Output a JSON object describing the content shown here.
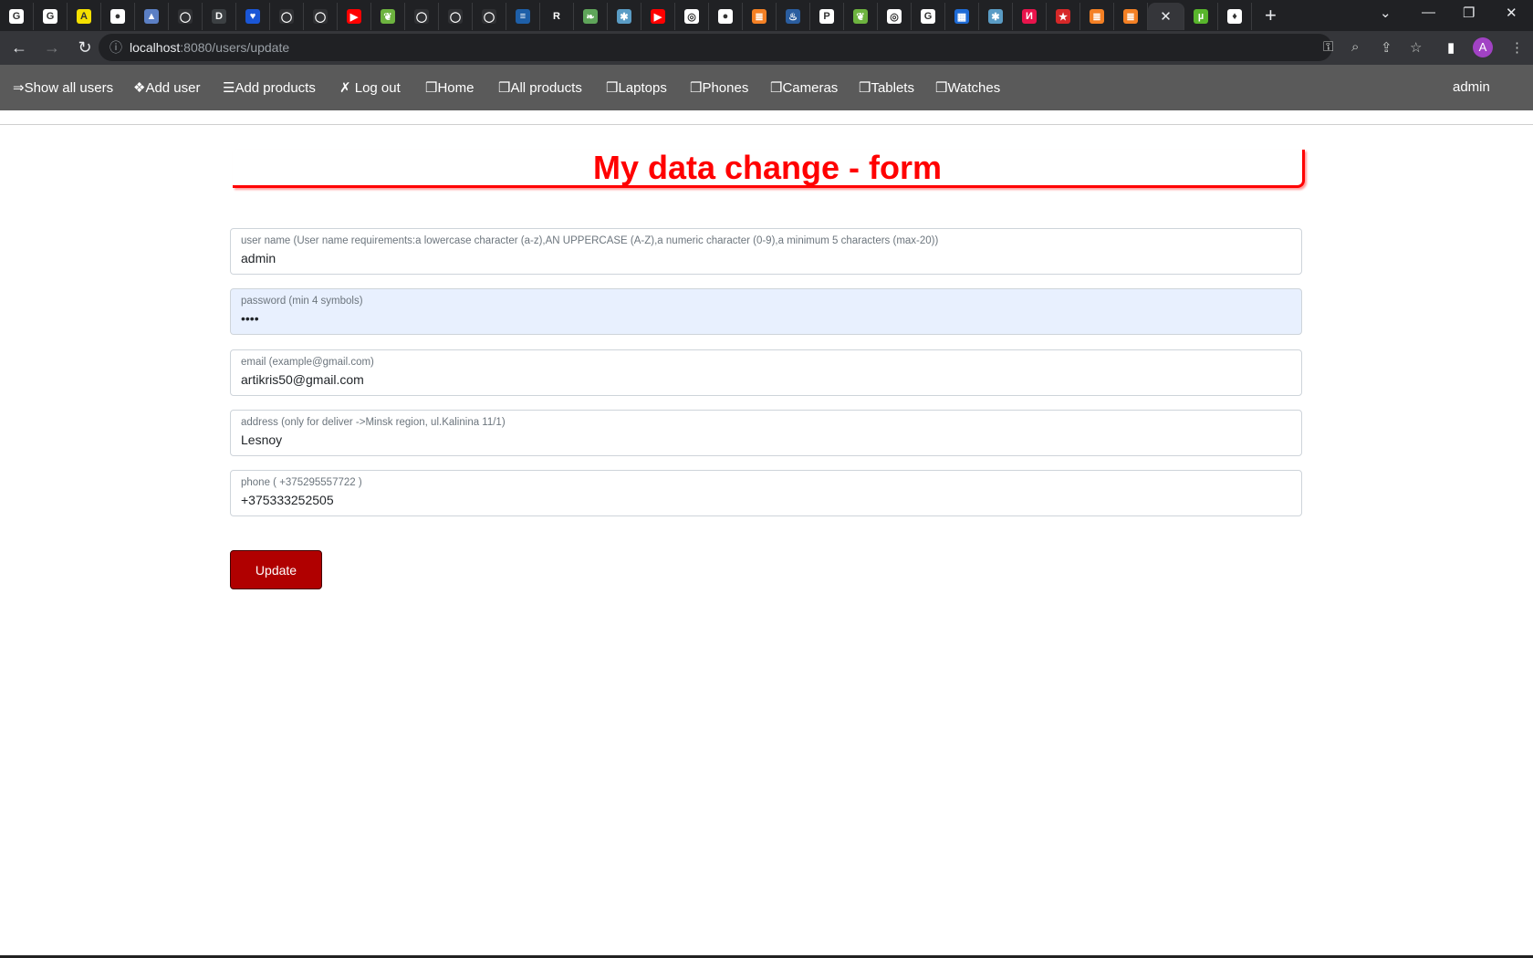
{
  "browser": {
    "tabs": [
      {
        "icon": "google-icon",
        "color": "#ffffff",
        "glyph": "G"
      },
      {
        "icon": "google-icon",
        "color": "#ffffff",
        "glyph": "G"
      },
      {
        "icon": "a-logo-icon",
        "color": "#f5e000",
        "glyph": "A"
      },
      {
        "icon": "globe-icon",
        "color": "#ffffff",
        "glyph": "●"
      },
      {
        "icon": "docs-icon",
        "color": "#5b7fc4",
        "glyph": "▲"
      },
      {
        "icon": "github-icon",
        "color": "#303134",
        "glyph": "◯"
      },
      {
        "icon": "d-logo-icon",
        "color": "#3c4043",
        "glyph": "D"
      },
      {
        "icon": "heart-icon",
        "color": "#1a56d6",
        "glyph": "♥"
      },
      {
        "icon": "github-icon",
        "color": "#303134",
        "glyph": "◯"
      },
      {
        "icon": "github-icon",
        "color": "#303134",
        "glyph": "◯"
      },
      {
        "icon": "youtube-icon",
        "color": "#ff0000",
        "glyph": "▶"
      },
      {
        "icon": "spring-icon",
        "color": "#6db33f",
        "glyph": "❦"
      },
      {
        "icon": "github-icon",
        "color": "#303134",
        "glyph": "◯"
      },
      {
        "icon": "github-icon",
        "color": "#303134",
        "glyph": "◯"
      },
      {
        "icon": "github-icon",
        "color": "#303134",
        "glyph": "◯"
      },
      {
        "icon": "stackexchange-icon",
        "color": "#1e5fa8",
        "glyph": "≡"
      },
      {
        "icon": "r5am-icon",
        "color": "#202124",
        "glyph": "R"
      },
      {
        "icon": "leaf-icon",
        "color": "#5fa55a",
        "glyph": "❧"
      },
      {
        "icon": "splash-icon",
        "color": "#5a9cc5",
        "glyph": "✱"
      },
      {
        "icon": "youtube-icon",
        "color": "#ff0000",
        "glyph": "▶"
      },
      {
        "icon": "chrome-icon",
        "color": "#ffffff",
        "glyph": "◎"
      },
      {
        "icon": "globe-icon",
        "color": "#ffffff",
        "glyph": "●"
      },
      {
        "icon": "stackoverflow-icon",
        "color": "#f48024",
        "glyph": "≣"
      },
      {
        "icon": "java-icon",
        "color": "#2a5d9f",
        "glyph": "♨"
      },
      {
        "icon": "bp-icon",
        "color": "#ffffff",
        "glyph": "P"
      },
      {
        "icon": "spring-icon",
        "color": "#6db33f",
        "glyph": "❦"
      },
      {
        "icon": "chrome-icon",
        "color": "#ffffff",
        "glyph": "◎"
      },
      {
        "icon": "google-icon",
        "color": "#ffffff",
        "glyph": "G"
      },
      {
        "icon": "table-icon",
        "color": "#1e6bd6",
        "glyph": "▦"
      },
      {
        "icon": "splash-icon",
        "color": "#5a9cc5",
        "glyph": "✱"
      },
      {
        "icon": "n-logo-icon",
        "color": "#e8144c",
        "glyph": "И"
      },
      {
        "icon": "star-logo-icon",
        "color": "#d62828",
        "glyph": "★"
      },
      {
        "icon": "stackoverflow-icon",
        "color": "#f48024",
        "glyph": "≣"
      },
      {
        "icon": "stackoverflow-icon",
        "color": "#f48024",
        "glyph": "≣"
      }
    ],
    "active_tab_close": "✕",
    "tabs_after": [
      {
        "icon": "utorrent-icon",
        "color": "#58b52c",
        "glyph": "µ"
      },
      {
        "icon": "flame-icon",
        "color": "#ffffff",
        "glyph": "♦"
      }
    ],
    "new_tab": "+",
    "url_host": "localhost",
    "url_path": ":8080/users/update",
    "profile_initial": "A"
  },
  "nav": {
    "items": [
      "⇒Show all users",
      "❖Add user",
      "☰Add products",
      "✗ Log out",
      "❒Home",
      "❒All products",
      "❒Laptops",
      "❒Phones",
      "❒Cameras",
      "❒Tablets",
      "❒Watches"
    ],
    "user": "admin"
  },
  "form": {
    "title": "My data change - form",
    "fields": [
      {
        "label": "user name (User name requirements:a lowercase character (a-z),AN UPPERCASE (A-Z),a numeric character (0-9),a minimum 5 characters (max-20))",
        "value": "admin",
        "type": "text"
      },
      {
        "label": "password (min 4 symbols)",
        "value": "1234",
        "type": "password"
      },
      {
        "label": "email (example@gmail.com)",
        "value": "artikris50@gmail.com",
        "type": "text"
      },
      {
        "label": "address (only for deliver ->Minsk region, ul.Kalinina 11/1)",
        "value": "Lesnoy",
        "type": "text"
      },
      {
        "label": "phone ( +375295557722 )",
        "value": "+375333252505",
        "type": "text"
      }
    ],
    "submit": "Update"
  },
  "colors": {
    "accent": "#ff0000",
    "button": "#b00000",
    "navbar": "#5a5a5a"
  }
}
